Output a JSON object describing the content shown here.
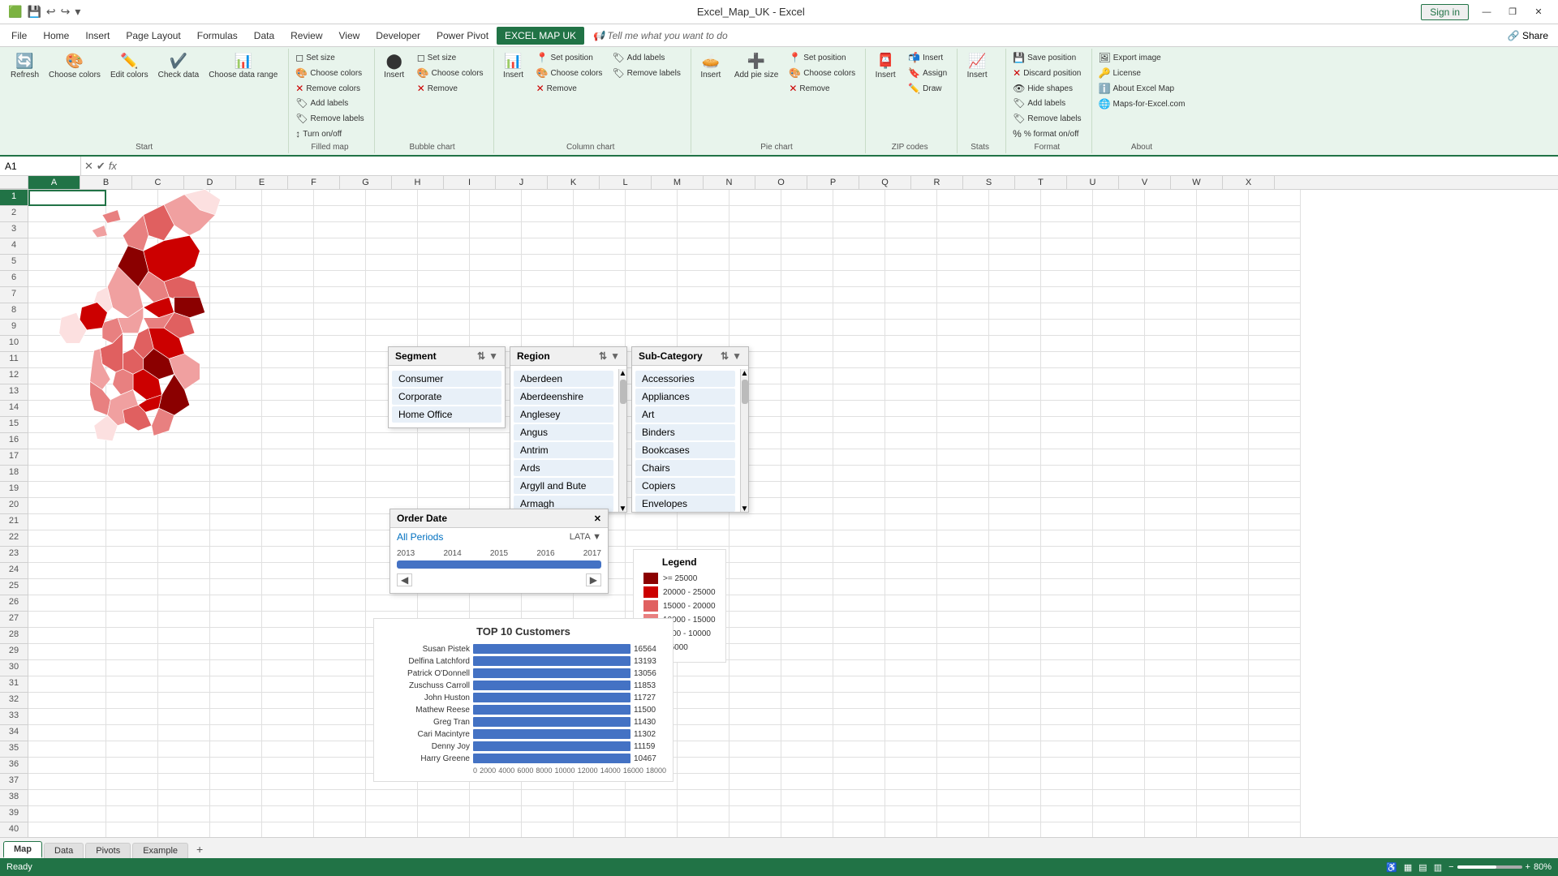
{
  "titlebar": {
    "title": "Excel_Map_UK - Excel",
    "signin": "Sign in",
    "minimize": "—",
    "restore": "❐",
    "close": "✕"
  },
  "menubar": {
    "items": [
      "File",
      "Home",
      "Insert",
      "Page Layout",
      "Formulas",
      "Data",
      "Review",
      "View",
      "Developer",
      "Power Pivot",
      "EXCEL MAP UK",
      "Tell me what you want to do"
    ]
  },
  "ribbon": {
    "groups": [
      {
        "label": "Start",
        "buttons": [
          {
            "icon": "🔄",
            "label": "Refresh"
          },
          {
            "icon": "🎨",
            "label": "Choose colors"
          },
          {
            "icon": "✏️",
            "label": "Edit colors"
          },
          {
            "icon": "✔️",
            "label": "Check data"
          },
          {
            "icon": "📊",
            "label": "Choose data range"
          }
        ]
      },
      {
        "label": "Filled map",
        "small_buttons": [
          {
            "icon": "◻",
            "label": "Set size"
          },
          {
            "icon": "🎨",
            "label": "Choose colors"
          },
          {
            "icon": "🔴",
            "label": "Remove colors"
          },
          {
            "icon": "🏷️",
            "label": "Add labels"
          },
          {
            "icon": "🏷️",
            "label": "Remove labels"
          },
          {
            "icon": "↕️",
            "label": "Turn on/off"
          }
        ]
      },
      {
        "label": "Bubble chart",
        "buttons": [
          {
            "icon": "⬤",
            "label": "Insert"
          }
        ],
        "small_buttons": [
          {
            "icon": "◻",
            "label": "Set size"
          },
          {
            "icon": "🎨",
            "label": "Choose colors"
          },
          {
            "icon": "❌",
            "label": "Remove"
          }
        ]
      },
      {
        "label": "Column chart",
        "buttons": [
          {
            "icon": "📊",
            "label": "Insert"
          }
        ],
        "small_buttons": [
          {
            "icon": "📍",
            "label": "Set position"
          },
          {
            "icon": "🎨",
            "label": "Choose colors"
          },
          {
            "icon": "❌",
            "label": "Remove"
          },
          {
            "icon": "🏷️",
            "label": "Add labels"
          },
          {
            "icon": "🏷️",
            "label": "Remove labels"
          }
        ]
      },
      {
        "label": "Pie chart",
        "buttons": [
          {
            "icon": "🥧",
            "label": "Insert"
          },
          {
            "icon": "➕",
            "label": "Add pie size"
          }
        ],
        "small_buttons": [
          {
            "icon": "📍",
            "label": "Set position"
          },
          {
            "icon": "🎨",
            "label": "Choose colors"
          },
          {
            "icon": "❌",
            "label": "Remove"
          }
        ]
      },
      {
        "label": "ZIP codes",
        "buttons": [
          {
            "icon": "📮",
            "label": "Insert"
          }
        ],
        "small_buttons": [
          {
            "icon": "📬",
            "label": "Insert"
          },
          {
            "icon": "🔖",
            "label": "Assign"
          },
          {
            "icon": "🖊️",
            "label": "Draw"
          }
        ]
      },
      {
        "label": "Stats",
        "buttons": [
          {
            "icon": "📈",
            "label": "Insert"
          }
        ]
      },
      {
        "label": "Format",
        "small_buttons": [
          {
            "icon": "💾",
            "label": "Save position"
          },
          {
            "icon": "❌",
            "label": "Discard position"
          },
          {
            "icon": "👁️",
            "label": "Hide shapes"
          },
          {
            "icon": "🏷️",
            "label": "Add labels"
          },
          {
            "icon": "🏷️",
            "label": "Remove labels"
          },
          {
            "icon": "%",
            "label": "% format on/off"
          }
        ]
      },
      {
        "label": "About",
        "small_buttons": [
          {
            "icon": "🖼️",
            "label": "Export image"
          },
          {
            "icon": "🔑",
            "label": "License"
          },
          {
            "icon": "ℹ️",
            "label": "About Excel Map"
          },
          {
            "icon": "🌐",
            "label": "Maps-for-Excel.com"
          }
        ]
      }
    ]
  },
  "formulabar": {
    "cell_name": "A1",
    "formula": ""
  },
  "columns": [
    "A",
    "B",
    "C",
    "D",
    "E",
    "F",
    "G",
    "H",
    "I",
    "J",
    "K",
    "L",
    "M",
    "N",
    "O",
    "P",
    "Q",
    "R",
    "S",
    "T",
    "U",
    "V",
    "W",
    "X"
  ],
  "rows": 40,
  "segment_panel": {
    "title": "Segment",
    "items": [
      "Consumer",
      "Corporate",
      "Home Office"
    ]
  },
  "region_panel": {
    "title": "Region",
    "items": [
      "Aberdeen",
      "Aberdeenshire",
      "Anglesey",
      "Angus",
      "Antrim",
      "Ards",
      "Argyll and Bute",
      "Armagh"
    ]
  },
  "subcategory_panel": {
    "title": "Sub-Category",
    "items": [
      "Accessories",
      "Appliances",
      "Art",
      "Binders",
      "Bookcases",
      "Chairs",
      "Copiers",
      "Envelopes"
    ]
  },
  "date_panel": {
    "title": "Order Date",
    "all_periods": "All Periods",
    "lata": "LATA ▼",
    "years": [
      "2013",
      "2014",
      "2015",
      "2016",
      "2017"
    ]
  },
  "legend": {
    "title": "Legend",
    "ranges": [
      {
        "label": ">= 25000",
        "color": "#8b0000"
      },
      {
        "label": "20000 - 25000",
        "color": "#cc0000"
      },
      {
        "label": "15000 - 20000",
        "color": "#e06060"
      },
      {
        "label": "10000 - 15000",
        "color": "#e88080"
      },
      {
        "label": "5000 - 10000",
        "color": "#f0a0a0"
      },
      {
        "label": "< 5000",
        "color": "#fce0e0"
      }
    ]
  },
  "chart": {
    "title": "TOP 10 Customers",
    "bars": [
      {
        "name": "Susan Pistek",
        "value": 16564,
        "max": 18000
      },
      {
        "name": "Delfina Latchford",
        "value": 13193,
        "max": 18000
      },
      {
        "name": "Patrick O'Donnell",
        "value": 13056,
        "max": 18000
      },
      {
        "name": "Zuschuss Carroll",
        "value": 11853,
        "max": 18000
      },
      {
        "name": "John Huston",
        "value": 11727,
        "max": 18000
      },
      {
        "name": "Mathew Reese",
        "value": 11500,
        "max": 18000
      },
      {
        "name": "Greg Tran",
        "value": 11430,
        "max": 18000
      },
      {
        "name": "Cari Macintyre",
        "value": 11302,
        "max": 18000
      },
      {
        "name": "Denny Joy",
        "value": 11159,
        "max": 18000
      },
      {
        "name": "Harry Greene",
        "value": 10467,
        "max": 18000
      }
    ],
    "axis_labels": [
      "0",
      "2000",
      "4000",
      "6000",
      "8000",
      "10000",
      "12000",
      "14000",
      "16000",
      "18000"
    ]
  },
  "sheets": [
    "Map",
    "Data",
    "Pivots",
    "Example"
  ],
  "active_sheet": "Map",
  "statusbar": {
    "ready": "Ready",
    "zoom": "80%"
  }
}
